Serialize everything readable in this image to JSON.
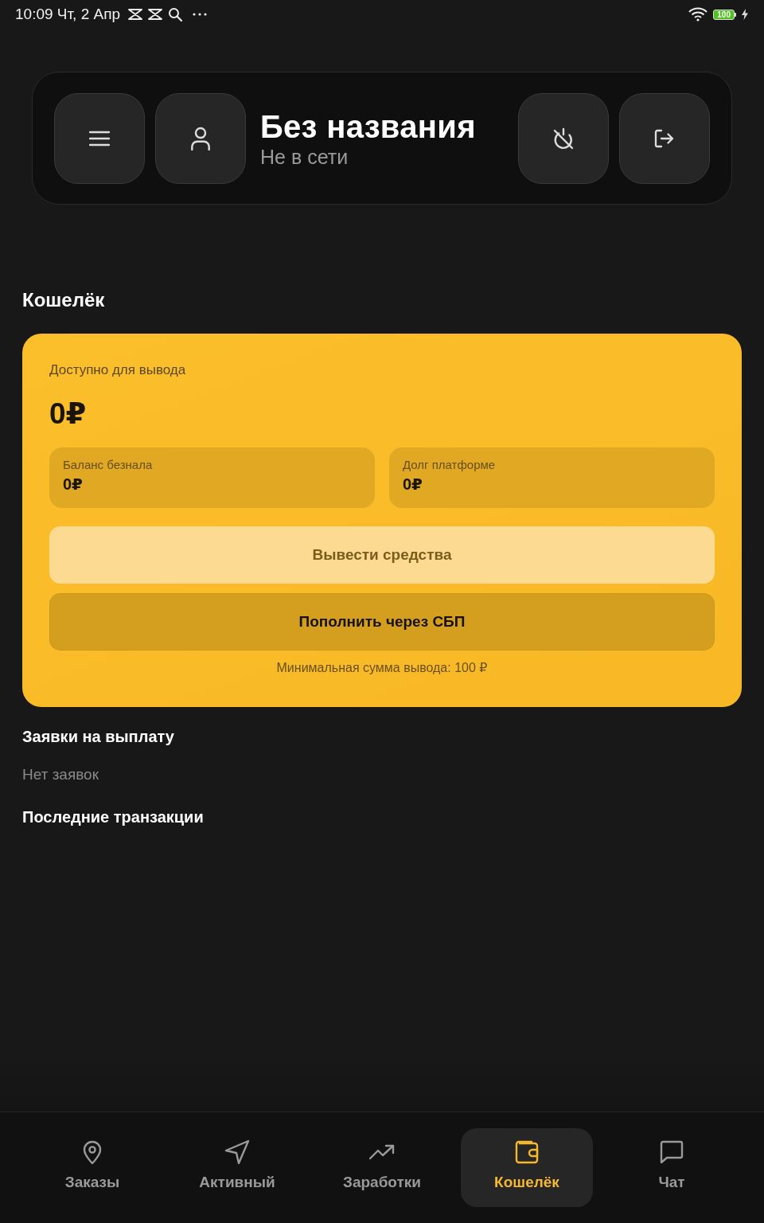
{
  "status_bar": {
    "datetime": "10:09 Чт, 2 Апр",
    "battery": "100"
  },
  "header": {
    "title": "Без названия",
    "status": "Не в сети"
  },
  "wallet": {
    "heading": "Кошелёк",
    "available_label": "Доступно для вывода",
    "available_amount": "0₽",
    "balances": [
      {
        "label": "Баланс безнала",
        "value": "0₽"
      },
      {
        "label": "Долг платформе",
        "value": "0₽"
      }
    ],
    "buttons": [
      {
        "label": "Вывести средства",
        "disabled": true
      },
      {
        "label": "Пополнить через СБП",
        "disabled": false
      }
    ],
    "note": "Минимальная сумма вывода: 100 ₽"
  },
  "payout_requests": {
    "heading": "Заявки на выплату",
    "empty_text": "Нет заявок"
  },
  "transactions": {
    "heading": "Последние транзакции"
  },
  "bottom_nav": [
    {
      "label": "Заказы",
      "selected": false
    },
    {
      "label": "Активный",
      "selected": false
    },
    {
      "label": "Заработки",
      "selected": false
    },
    {
      "label": "Кошелёк",
      "selected": true
    },
    {
      "label": "Чат",
      "selected": false
    }
  ]
}
